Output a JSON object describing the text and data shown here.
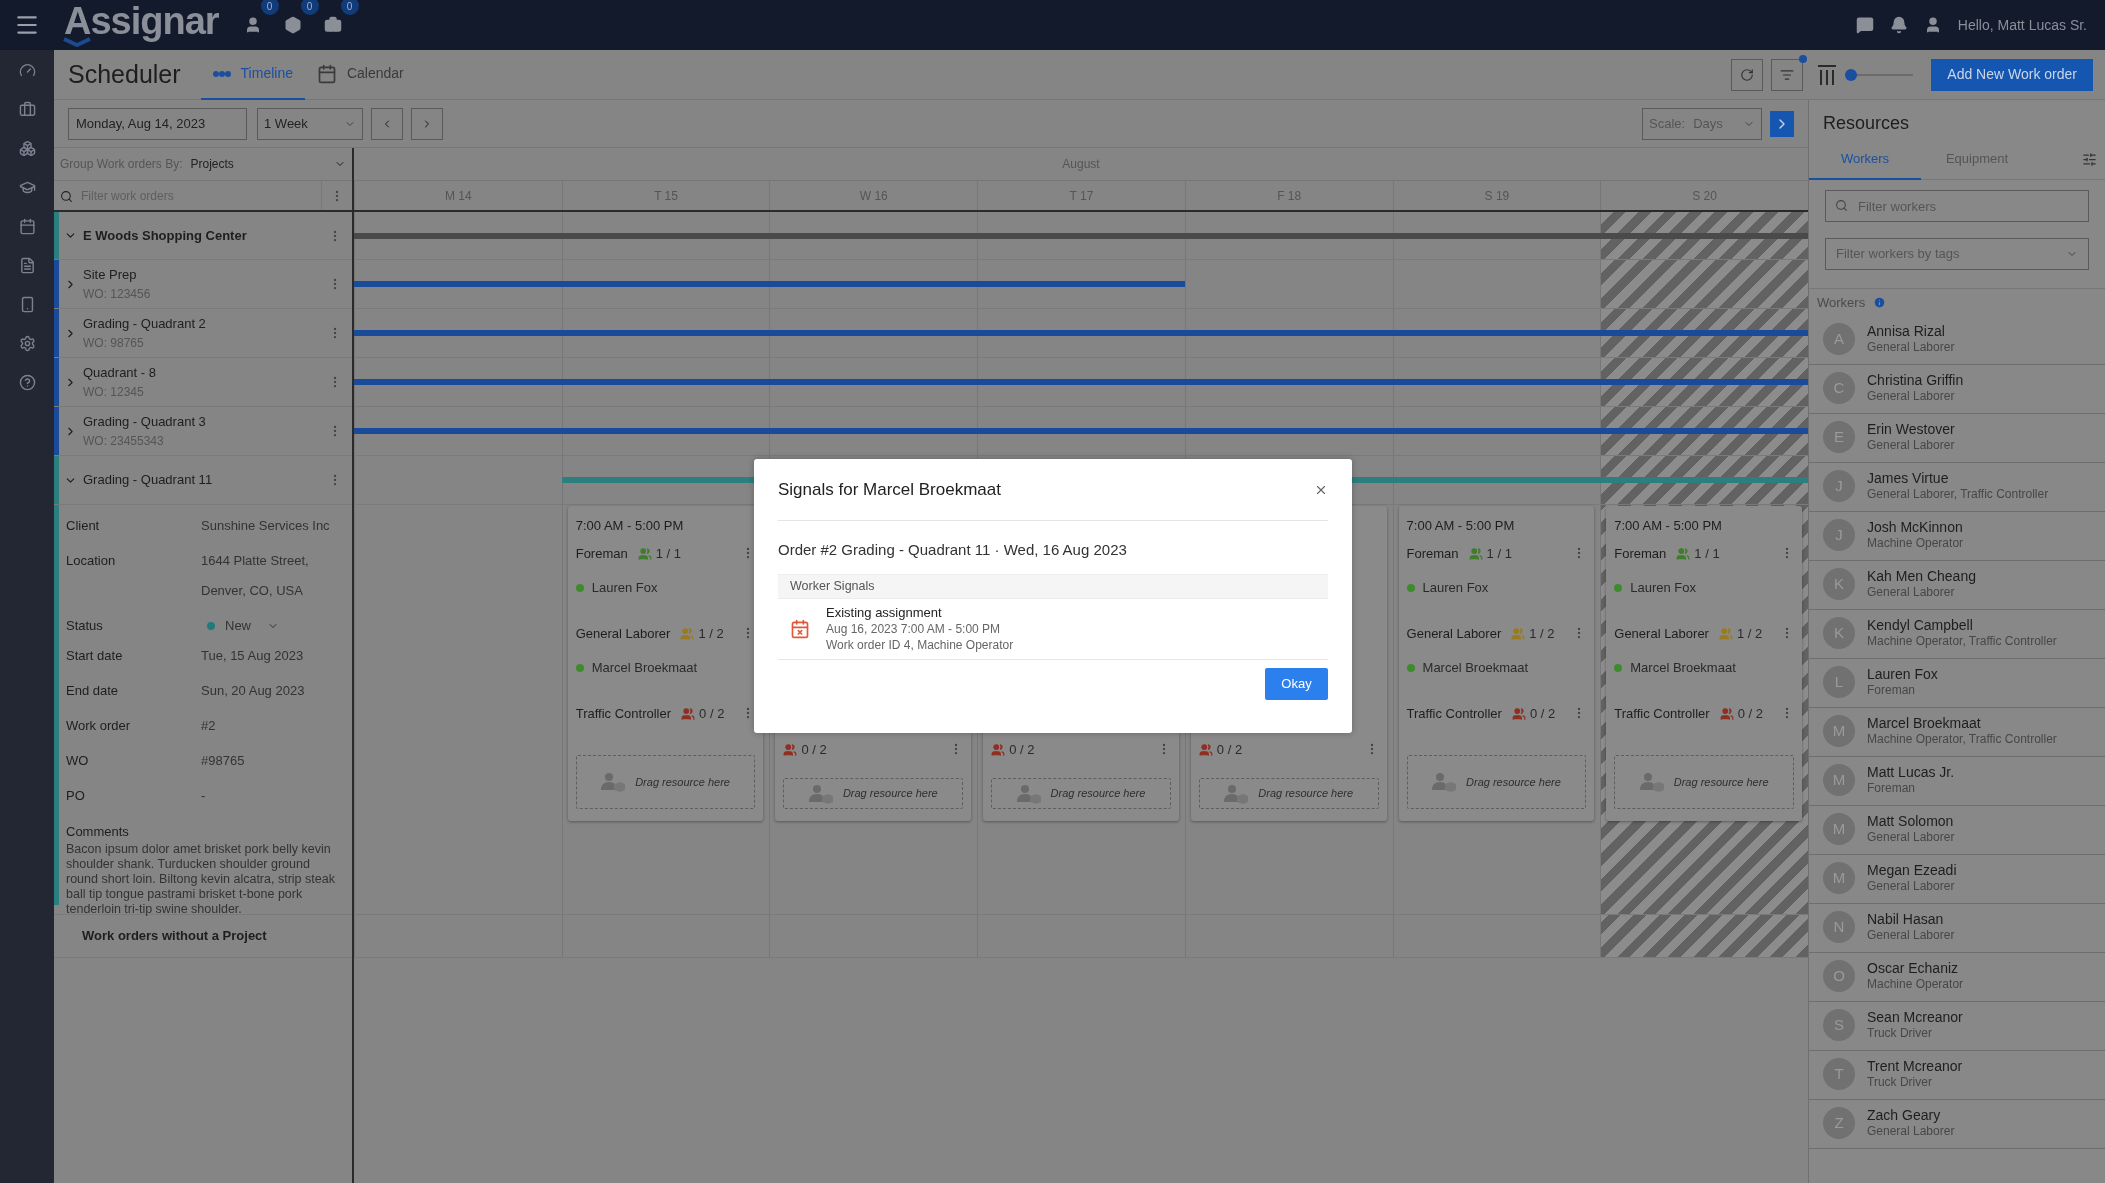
{
  "top_bar": {
    "logo": "Assignar",
    "badges": [
      "0",
      "0",
      "0"
    ],
    "greeting": "Hello, Matt Lucas Sr."
  },
  "header": {
    "title": "Scheduler",
    "tabs": [
      {
        "label": "Timeline",
        "selected": true
      },
      {
        "label": "Calendar",
        "selected": false
      }
    ],
    "filter_active": true,
    "zoom": {
      "level": 0
    },
    "add_button": "Add New Work order"
  },
  "toolbar": {
    "date": "Monday, Aug 14, 2023",
    "range": "1 Week",
    "scale_label": "Scale:",
    "scale": "Days"
  },
  "work_orders": {
    "group_label": "Group Work orders By:",
    "group_value": "Projects",
    "filter_placeholder": "Filter work orders",
    "rows": [
      {
        "kind": "project",
        "name": "E Woods Shopping Center",
        "expanded": true,
        "color": "#2b7f7f",
        "bar": [
          true,
          true,
          true,
          true,
          true,
          true,
          true
        ]
      },
      {
        "kind": "work_order",
        "name": "Site Prep",
        "wo": "WO: 123456",
        "expanded": false,
        "color": "#1a4a9a",
        "bar": [
          true,
          true,
          true,
          true,
          false,
          false,
          false
        ]
      },
      {
        "kind": "work_order",
        "name": "Grading - Quadrant 2",
        "wo": "WO: 98765",
        "expanded": false,
        "color": "#1a4a9a",
        "bar": [
          true,
          true,
          true,
          true,
          true,
          true,
          true
        ]
      },
      {
        "kind": "work_order",
        "name": "Quadrant - 8",
        "wo": "WO: 12345",
        "expanded": false,
        "color": "#1a4a9a",
        "bar": [
          true,
          true,
          true,
          true,
          true,
          true,
          true
        ]
      },
      {
        "kind": "work_order",
        "name": "Grading - Quadrant 3",
        "wo": "WO: 23455343",
        "expanded": false,
        "color": "#1a4a9a",
        "bar": [
          true,
          true,
          true,
          true,
          true,
          true,
          true
        ]
      },
      {
        "kind": "work_order",
        "name": "Grading - Quadrant 11",
        "expanded": true,
        "color": "#2b7f7f",
        "bar": [
          false,
          true,
          true,
          true,
          true,
          true,
          true
        ],
        "details": [
          {
            "kind": "text",
            "label": "Client",
            "value": "Sunshine Services Inc"
          },
          {
            "kind": "text",
            "label": "Location",
            "value": "1644 Platte Street, Denver, CO, USA"
          },
          {
            "kind": "status",
            "label": "Status",
            "value": "New",
            "color": "#237a7a"
          },
          {
            "kind": "text",
            "label": "Start date",
            "value": "Tue, 15 Aug 2023"
          },
          {
            "kind": "text",
            "label": "End date",
            "value": "Sun, 20 Aug 2023"
          },
          {
            "kind": "text",
            "label": "Work order",
            "value": "#2"
          },
          {
            "kind": "text",
            "label": "WO",
            "value": "#98765"
          },
          {
            "kind": "text",
            "label": "PO",
            "value": "-"
          }
        ],
        "comments_label": "Comments",
        "comments": "Bacon ipsum dolor amet brisket pork belly kevin shoulder shank. Turducken shoulder ground round short loin. Biltong kevin alcatra, strip steak ball tip tongue pastrami brisket t-bone pork tenderloin tri-tip swine shoulder.",
        "shifts": [
          {
            "time": "7:00 AM - 5:00 PM",
            "roles": [
              {
                "name": "Foreman",
                "count": "1 / 1",
                "color": "#3f7d2a",
                "workers": [
                  "Lauren Fox"
                ]
              },
              {
                "name": "General Laborer",
                "count": "1 / 2",
                "color": "#9a7a1e",
                "workers": [
                  "Marcel Broekmaat"
                ]
              },
              {
                "name": "Traffic Controller",
                "count": "0 / 2",
                "color": "#8e2f22"
              }
            ],
            "drop_label": "Drag resource here"
          },
          {
            "roles": [
              {
                "count": "0 / 2",
                "color": "#8e2f22"
              }
            ],
            "drop_label": "Drag resource here"
          },
          {
            "roles": [
              {
                "count": "0 / 2",
                "color": "#8e2f22"
              }
            ],
            "drop_label": "Drag resource here"
          },
          {
            "roles": [
              {
                "count": "0 / 2",
                "color": "#8e2f22"
              }
            ],
            "drop_label": "Drag resource here"
          },
          {
            "time": "7:00 AM - 5:00 PM",
            "roles": [
              {
                "name": "Foreman",
                "count": "1 / 1",
                "color": "#3f7d2a",
                "workers": [
                  "Lauren Fox"
                ]
              },
              {
                "name": "General Laborer",
                "count": "1 / 2",
                "color": "#9a7a1e",
                "workers": [
                  "Marcel Broekmaat"
                ]
              },
              {
                "name": "Traffic Controller",
                "count": "0 / 2",
                "color": "#8e2f22"
              }
            ],
            "drop_label": "Drag resource here"
          },
          {
            "time": "7:00 AM - 5:00 PM",
            "roles": [
              {
                "name": "Foreman",
                "count": "1 / 1",
                "color": "#3f7d2a",
                "workers": [
                  "Lauren Fox"
                ]
              },
              {
                "name": "General Laborer",
                "count": "1 / 2",
                "color": "#9a7a1e",
                "workers": [
                  "Marcel Broekmaat"
                ]
              },
              {
                "name": "Traffic Controller",
                "count": "0 / 2",
                "color": "#8e2f22"
              }
            ],
            "drop_label": "Drag resource here"
          }
        ]
      }
    ],
    "unassigned": "Work orders without a Project"
  },
  "timeline": {
    "month": "August",
    "days": [
      {
        "label": "M 14",
        "non_working": false
      },
      {
        "label": "T 15",
        "non_working": false
      },
      {
        "label": "W 16",
        "non_working": false
      },
      {
        "label": "T 17",
        "non_working": false
      },
      {
        "label": "F 18",
        "non_working": false
      },
      {
        "label": "S 19",
        "non_working": false
      },
      {
        "label": "S 20",
        "non_working": true
      }
    ]
  },
  "resources": {
    "title": "Resources",
    "tabs": [
      {
        "label": "Workers",
        "selected": true
      },
      {
        "label": "Equipment",
        "selected": false
      }
    ],
    "search_placeholder": "Filter workers",
    "tags_placeholder": "Filter workers by tags",
    "section": "Workers",
    "workers": [
      {
        "initial": "A",
        "name": "Annisa Rizal",
        "roles": "General Laborer"
      },
      {
        "initial": "C",
        "name": "Christina Griffin",
        "roles": "General Laborer"
      },
      {
        "initial": "E",
        "name": "Erin Westover",
        "roles": "General Laborer"
      },
      {
        "initial": "J",
        "name": "James Virtue",
        "roles": "General Laborer, Traffic Controller"
      },
      {
        "initial": "J",
        "name": "Josh McKinnon",
        "roles": "Machine Operator"
      },
      {
        "initial": "K",
        "name": "Kah Men Cheang",
        "roles": "General Laborer"
      },
      {
        "initial": "K",
        "name": "Kendyl Campbell",
        "roles": "Machine Operator, Traffic Controller"
      },
      {
        "initial": "L",
        "name": "Lauren Fox",
        "roles": "Foreman"
      },
      {
        "initial": "M",
        "name": "Marcel Broekmaat",
        "roles": "Machine Operator, Traffic Controller"
      },
      {
        "initial": "M",
        "name": "Matt Lucas Jr.",
        "roles": "Foreman"
      },
      {
        "initial": "M",
        "name": "Matt Solomon",
        "roles": "General Laborer"
      },
      {
        "initial": "M",
        "name": "Megan Ezeadi",
        "roles": "General Laborer"
      },
      {
        "initial": "N",
        "name": "Nabil Hasan",
        "roles": "General Laborer"
      },
      {
        "initial": "O",
        "name": "Oscar Echaniz",
        "roles": "Machine Operator"
      },
      {
        "initial": "S",
        "name": "Sean Mcreanor",
        "roles": "Truck Driver"
      },
      {
        "initial": "T",
        "name": "Trent Mcreanor",
        "roles": "Truck Driver"
      },
      {
        "initial": "Z",
        "name": "Zach Geary",
        "roles": "General Laborer"
      }
    ]
  },
  "modal": {
    "title": "Signals for Marcel Broekmaat",
    "subtitle": "Order #2 Grading - Quadrant 11 · Wed, 16 Aug 2023",
    "section": "Worker Signals",
    "signals": [
      {
        "title": "Existing assignment",
        "lines": [
          "Aug 16, 2023 7:00 AM - 5:00 PM",
          "Work order ID 4, Machine Operator"
        ]
      }
    ],
    "button": "Okay"
  }
}
